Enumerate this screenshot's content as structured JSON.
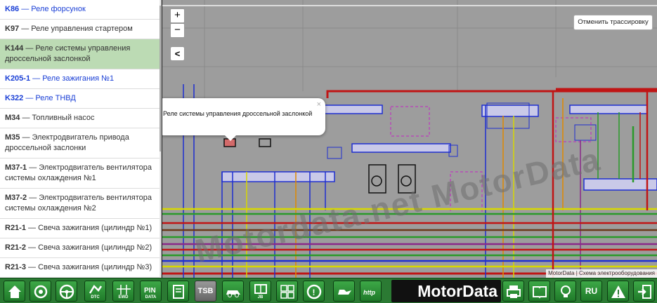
{
  "sidebar": {
    "items": [
      {
        "code": "K86",
        "name": " — Реле форсунок",
        "style": "link"
      },
      {
        "code": "K97",
        "name": " — Реле управления стартером",
        "style": "normal"
      },
      {
        "code": "K144",
        "name": " — Реле системы управления дроссельной заслонкой",
        "style": "active"
      },
      {
        "code": "K205-1",
        "name": " — Реле зажигания №1",
        "style": "link"
      },
      {
        "code": "K322",
        "name": " — Реле ТНВД",
        "style": "link"
      },
      {
        "code": "M34",
        "name": " — Топливный насос",
        "style": "normal"
      },
      {
        "code": "M35",
        "name": " — Электродвигатель привода дроссельной заслонки",
        "style": "normal"
      },
      {
        "code": "M37-1",
        "name": " — Электродвигатель вентилятора системы охлаждения №1",
        "style": "normal"
      },
      {
        "code": "M37-2",
        "name": " — Электродвигатель вентилятора системы охлаждения №2",
        "style": "normal"
      },
      {
        "code": "R21-1",
        "name": " — Свеча зажигания (цилиндр №1)",
        "style": "normal"
      },
      {
        "code": "R21-2",
        "name": " — Свеча зажигания (цилиндр №2)",
        "style": "normal"
      },
      {
        "code": "R21-3",
        "name": " — Свеча зажигания (цилиндр №3)",
        "style": "normal"
      }
    ]
  },
  "map": {
    "zoom_in": "+",
    "zoom_out": "−",
    "collapse": "<",
    "cancel_trace": "Отменить трассировку",
    "popup_text": "Реле системы управления дроссельной заслонкой",
    "popup_close": "×",
    "attribution": "MotorData | Схема электрооборудования",
    "watermark": "Motordata.net   MotorData"
  },
  "toolbar": {
    "logo": "MotorData",
    "tsb": "TSB",
    "lang": "RU",
    "buttons": [
      {
        "name": "home-button",
        "icon": "home-icon",
        "label": ""
      },
      {
        "name": "service-button",
        "icon": "service-icon",
        "label": ""
      },
      {
        "name": "steering-button",
        "icon": "steering-wheel-icon",
        "label": ""
      },
      {
        "name": "dtc-button",
        "icon": "dtc-icon",
        "label": "DTC"
      },
      {
        "name": "ewd-button",
        "icon": "ewd-icon",
        "label": "EWD"
      },
      {
        "name": "pin-data-button",
        "icon": "pin-data-icon",
        "label": "DATA"
      },
      {
        "name": "manual-button",
        "icon": "manual-icon",
        "label": ""
      },
      {
        "name": "body-repair-button",
        "icon": "body-repair-icon",
        "label": ""
      },
      {
        "name": "jb-button",
        "icon": "junction-block-icon",
        "label": "JB"
      },
      {
        "name": "connectors-button",
        "icon": "connectors-icon",
        "label": ""
      },
      {
        "name": "brakes-button",
        "icon": "brake-icon",
        "label": ""
      },
      {
        "name": "oil-button",
        "icon": "oil-can-icon",
        "label": ""
      },
      {
        "name": "web-button",
        "icon": "http-icon",
        "label": ""
      },
      {
        "name": "print-button",
        "icon": "printer-icon",
        "label": ""
      },
      {
        "name": "book-button",
        "icon": "book-icon",
        "label": ""
      },
      {
        "name": "tips-button",
        "icon": "lightbulb-icon",
        "label": ""
      },
      {
        "name": "warning-button",
        "icon": "warning-icon",
        "label": ""
      },
      {
        "name": "exit-button",
        "icon": "exit-icon",
        "label": ""
      }
    ]
  }
}
